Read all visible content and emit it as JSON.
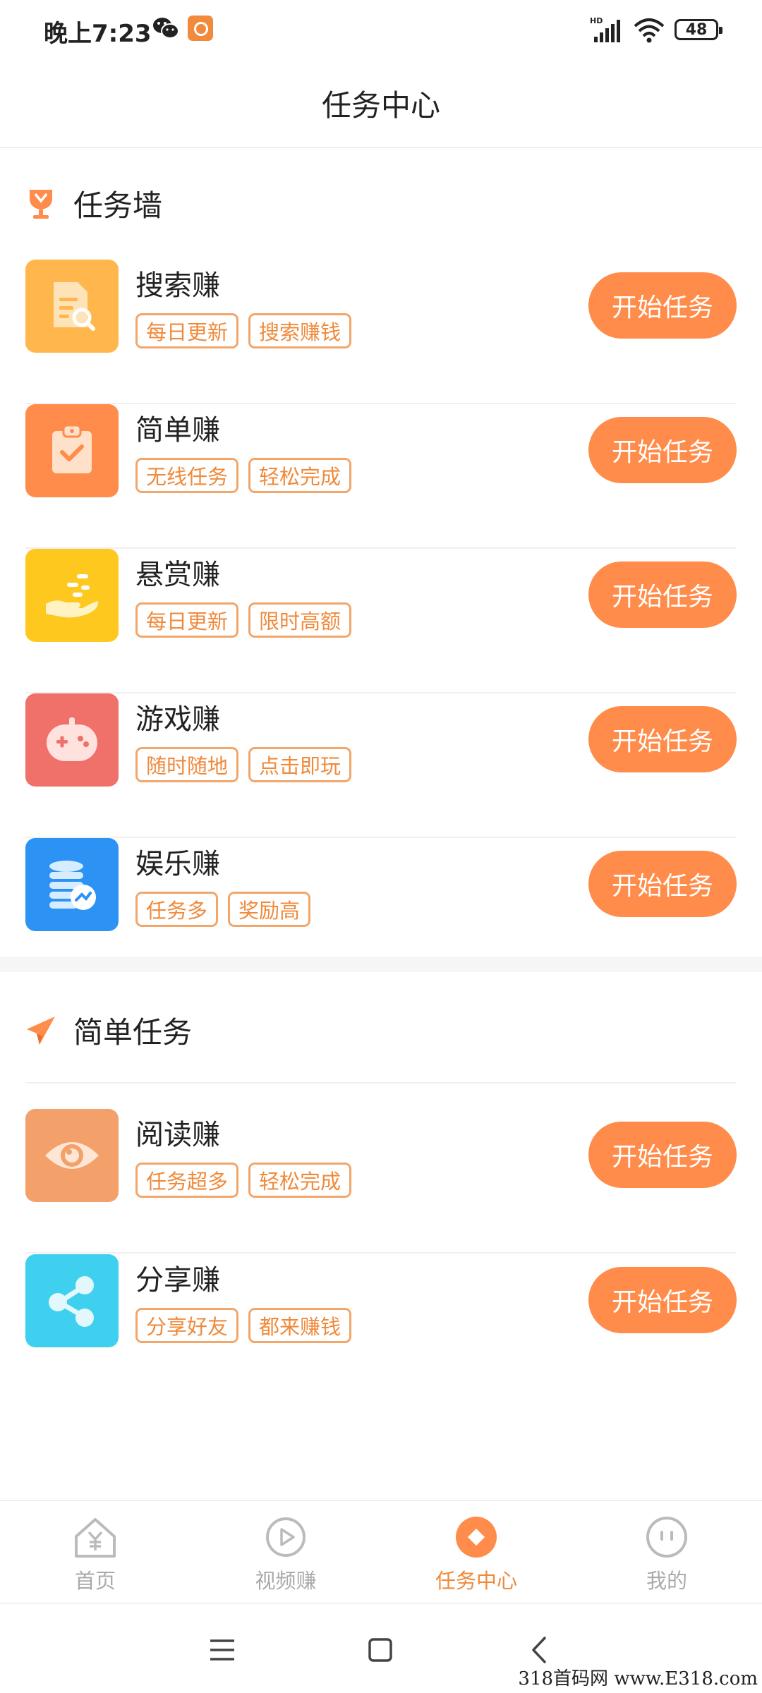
{
  "status": {
    "time": "晚上7:23",
    "network": "HD",
    "battery": "48"
  },
  "header": {
    "title": "任务中心"
  },
  "sections": [
    {
      "title": "任务墙",
      "icon": "trophy-icon",
      "items": [
        {
          "name": "搜索赚",
          "tags": [
            "每日更新",
            "搜索赚钱"
          ],
          "button": "开始任务",
          "icon": "document-search-icon",
          "color": "#FFB74D"
        },
        {
          "name": "简单赚",
          "tags": [
            "无线任务",
            "轻松完成"
          ],
          "button": "开始任务",
          "icon": "clipboard-check-icon",
          "color": "#FF8C4A"
        },
        {
          "name": "悬赏赚",
          "tags": [
            "每日更新",
            "限时高额"
          ],
          "button": "开始任务",
          "icon": "hand-coins-icon",
          "color": "#FFC81E"
        },
        {
          "name": "游戏赚",
          "tags": [
            "随时随地",
            "点击即玩"
          ],
          "button": "开始任务",
          "icon": "gamepad-icon",
          "color": "#F0706A"
        },
        {
          "name": "娱乐赚",
          "tags": [
            "任务多",
            "奖励高"
          ],
          "button": "开始任务",
          "icon": "coin-stack-icon",
          "color": "#2C93F5"
        }
      ]
    },
    {
      "title": "简单任务",
      "icon": "paper-plane-icon",
      "items": [
        {
          "name": "阅读赚",
          "tags": [
            "任务超多",
            "轻松完成"
          ],
          "button": "开始任务",
          "icon": "eye-icon",
          "color": "#F4A06A"
        },
        {
          "name": "分享赚",
          "tags": [
            "分享好友",
            "都来赚钱"
          ],
          "button": "开始任务",
          "icon": "share-icon",
          "color": "#3ED0EE"
        }
      ]
    }
  ],
  "tabs": [
    {
      "label": "首页",
      "icon": "home-yen-icon",
      "active": false
    },
    {
      "label": "视频赚",
      "icon": "play-circle-icon",
      "active": false
    },
    {
      "label": "任务中心",
      "icon": "task-diamond-icon",
      "active": true
    },
    {
      "label": "我的",
      "icon": "profile-face-icon",
      "active": false
    }
  ],
  "colors": {
    "accent": "#FF8C4A",
    "tag_text": "#F08A3B",
    "tag_border": "#F3A66A"
  },
  "watermark": "318首码网 www.E318.com"
}
